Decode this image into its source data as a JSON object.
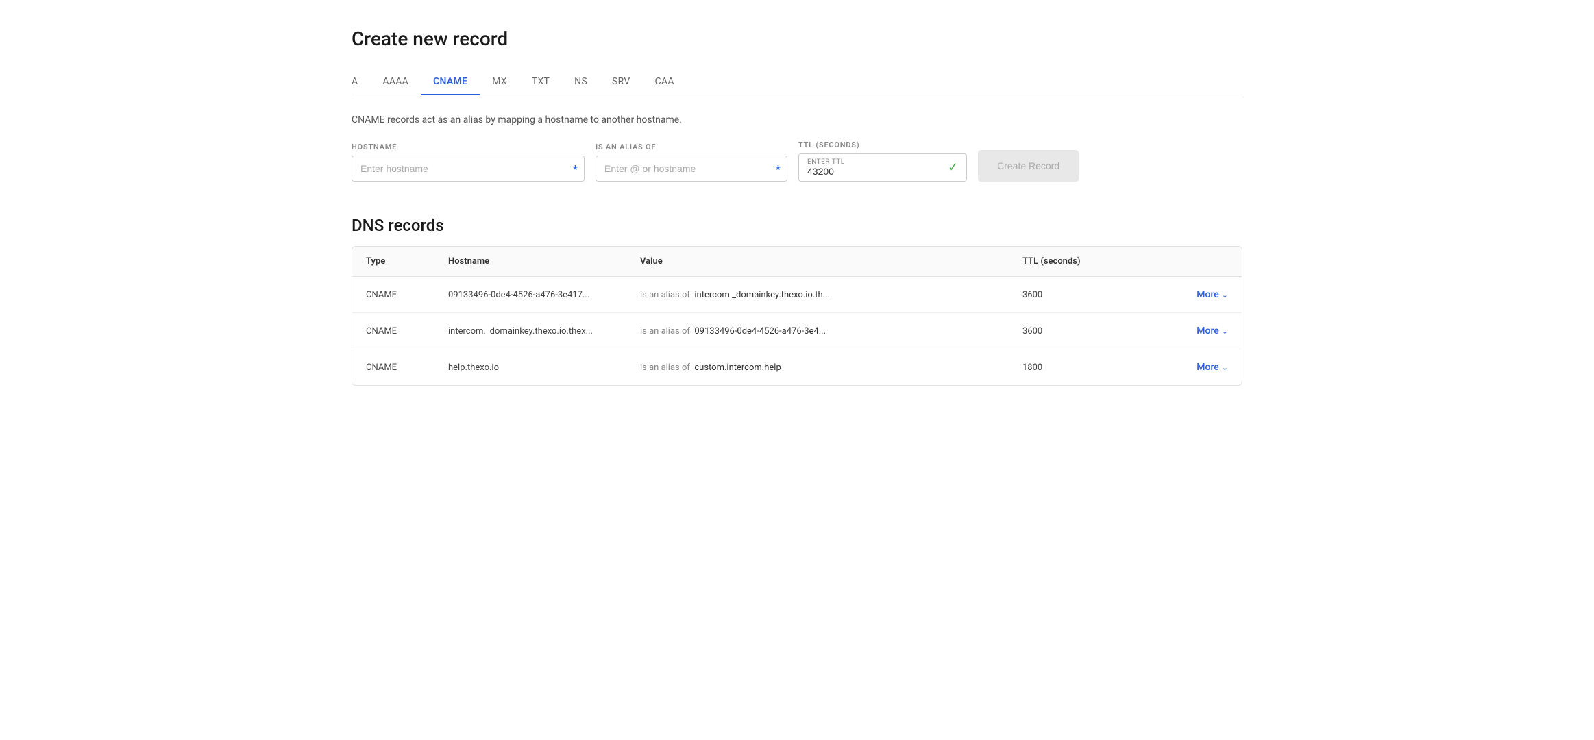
{
  "page": {
    "title": "Create new record"
  },
  "tabs": {
    "items": [
      {
        "id": "A",
        "label": "A",
        "active": false
      },
      {
        "id": "AAAA",
        "label": "AAAA",
        "active": false
      },
      {
        "id": "CNAME",
        "label": "CNAME",
        "active": true
      },
      {
        "id": "MX",
        "label": "MX",
        "active": false
      },
      {
        "id": "TXT",
        "label": "TXT",
        "active": false
      },
      {
        "id": "NS",
        "label": "NS",
        "active": false
      },
      {
        "id": "SRV",
        "label": "SRV",
        "active": false
      },
      {
        "id": "CAA",
        "label": "CAA",
        "active": false
      }
    ]
  },
  "form": {
    "description": "CNAME records act as an alias by mapping a hostname to another hostname.",
    "hostname_label": "HOSTNAME",
    "hostname_placeholder": "Enter hostname",
    "alias_label": "IS AN ALIAS OF",
    "alias_placeholder": "Enter @ or hostname",
    "ttl_label": "TTL (SECONDS)",
    "ttl_input_label": "Enter TTL",
    "ttl_value": "43200",
    "create_button_label": "Create Record"
  },
  "dns_section": {
    "title": "DNS records",
    "columns": [
      "Type",
      "Hostname",
      "Value",
      "TTL (seconds)",
      ""
    ],
    "rows": [
      {
        "type": "CNAME",
        "hostname": "09133496-0de4-4526-a476-3e417...",
        "value_prefix": "is an alias of",
        "value_main": "intercom._domainkey.thexo.io.th...",
        "ttl": "3600",
        "more": "More"
      },
      {
        "type": "CNAME",
        "hostname": "intercom._domainkey.thexo.io.thex...",
        "value_prefix": "is an alias of",
        "value_main": "09133496-0de4-4526-a476-3e4...",
        "ttl": "3600",
        "more": "More"
      },
      {
        "type": "CNAME",
        "hostname": "help.thexo.io",
        "value_prefix": "is an alias of",
        "value_main": "custom.intercom.help",
        "ttl": "1800",
        "more": "More"
      }
    ]
  },
  "colors": {
    "active_tab": "#2c5fdf",
    "check_green": "#4caf50",
    "more_blue": "#2c5fdf"
  }
}
